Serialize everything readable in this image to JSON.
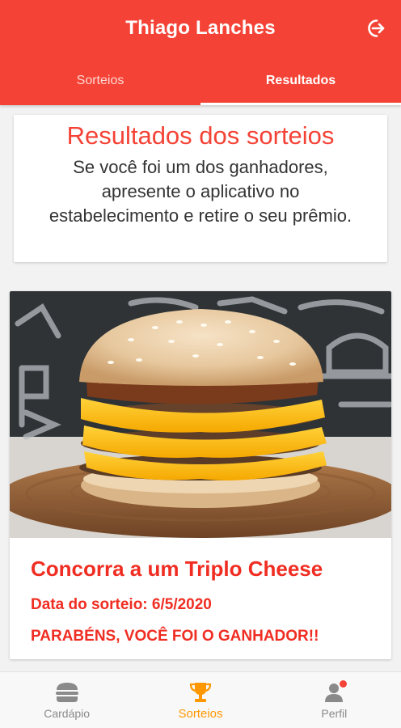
{
  "app": {
    "title": "Thiago Lanches",
    "logout_icon": "logout-icon",
    "brand_color": "#f44336"
  },
  "tabs": [
    {
      "label": "Sorteios",
      "active": false
    },
    {
      "label": "Resultados",
      "active": true
    }
  ],
  "info_card": {
    "heading": "Resultados dos sorteios",
    "description": "Se você foi um dos ganhadores, apresente o aplicativo no estabelecimento e retire o seu prêmio."
  },
  "draw": {
    "image": "triple-cheeseburger-photo",
    "name": "Concorra a um Triplo Cheese",
    "date": "Data do sorteio: 6/5/2020",
    "result": "PARABÉNS, VOCÊ FOI O GANHADOR!!"
  },
  "bottom_nav": {
    "items": [
      {
        "label": "Cardápio",
        "icon": "burger-icon",
        "active": false
      },
      {
        "label": "Sorteios",
        "icon": "trophy-icon",
        "active": true
      },
      {
        "label": "Perfil",
        "icon": "user-icon",
        "active": false,
        "badge": true
      }
    ],
    "active_color": "#ff9800",
    "inactive_color": "#8a8a8a"
  }
}
